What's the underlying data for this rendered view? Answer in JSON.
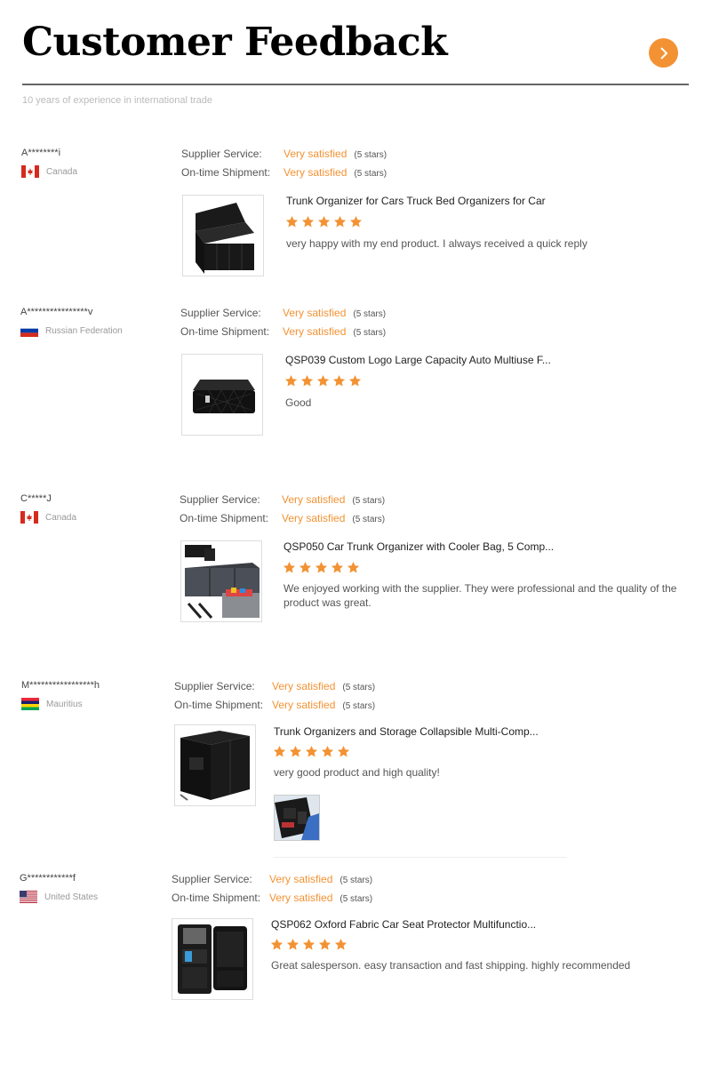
{
  "header": {
    "title": "Customer Feedback",
    "subtitle": "10 years of experience in international trade",
    "next_icon": "chevron-right-icon",
    "accent_color": "#f39233"
  },
  "labels": {
    "supplier_service": "Supplier Service:",
    "on_time_shipment": "On-time Shipment:"
  },
  "reviews": [
    {
      "buyer": "A********i",
      "country": "Canada",
      "flag": "canada-flag-icon",
      "supplier_service": "Very satisfied",
      "supplier_service_stars": "(5 stars)",
      "on_time_shipment": "Very satisfied",
      "on_time_shipment_stars": "(5 stars)",
      "product": "Trunk Organizer for Cars Truck Bed Organizers for Car",
      "rating": 5,
      "comment": "very happy with my end product. I always received a quick reply"
    },
    {
      "buyer": "A****************v",
      "country": "Russian Federation",
      "flag": "russia-flag-icon",
      "supplier_service": "Very satisfied",
      "supplier_service_stars": "(5 stars)",
      "on_time_shipment": "Very satisfied",
      "on_time_shipment_stars": "(5 stars)",
      "product": "QSP039 Custom Logo Large Capacity Auto Multiuse F...",
      "rating": 5,
      "comment": "Good"
    },
    {
      "buyer": "C*****J",
      "country": "Canada",
      "flag": "canada-flag-icon",
      "supplier_service": "Very satisfied",
      "supplier_service_stars": "(5 stars)",
      "on_time_shipment": "Very satisfied",
      "on_time_shipment_stars": "(5 stars)",
      "product": "QSP050 Car Trunk Organizer with Cooler Bag, 5 Comp...",
      "rating": 5,
      "comment": "We enjoyed working with the supplier. They were professional and the quality of the product was great."
    },
    {
      "buyer": "M*****************h",
      "country": "Mauritius",
      "flag": "mauritius-flag-icon",
      "supplier_service": "Very satisfied",
      "supplier_service_stars": "(5 stars)",
      "on_time_shipment": "Very satisfied",
      "on_time_shipment_stars": "(5 stars)",
      "product": "Trunk Organizers and Storage Collapsible Multi-Comp...",
      "rating": 5,
      "comment": "very good product and high quality!"
    },
    {
      "buyer": "G************f",
      "country": "United States",
      "flag": "usa-flag-icon",
      "supplier_service": "Very satisfied",
      "supplier_service_stars": "(5 stars)",
      "on_time_shipment": "Very satisfied",
      "on_time_shipment_stars": "(5 stars)",
      "product": "QSP062 Oxford Fabric Car Seat Protector Multifunctio...",
      "rating": 5,
      "comment": "Great salesperson. easy transaction and fast shipping. highly recommended"
    }
  ]
}
